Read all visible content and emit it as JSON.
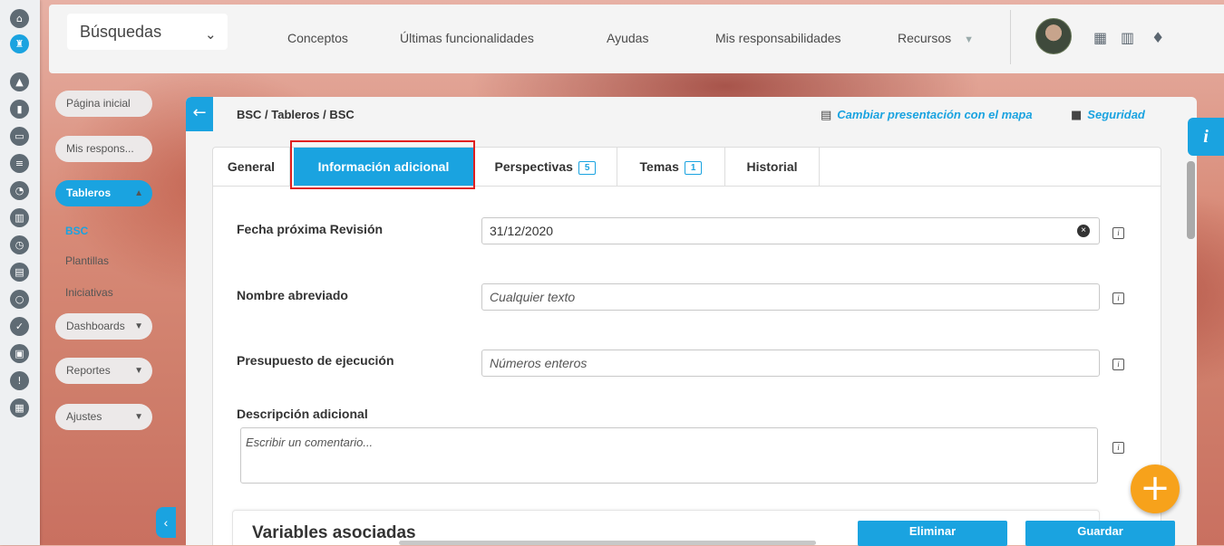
{
  "topbar": {
    "search_label": "Búsquedas",
    "nav": [
      "Conceptos",
      "Últimas funcionalidades",
      "Ayudas",
      "Mis responsabilidades",
      "Recursos"
    ]
  },
  "sidebar": {
    "items": [
      {
        "label": "Página inicial"
      },
      {
        "label": "Mis respons..."
      },
      {
        "label": "Tableros"
      },
      {
        "label": "BSC"
      },
      {
        "label": "Plantillas"
      },
      {
        "label": "Iniciativas"
      },
      {
        "label": "Dashboards"
      },
      {
        "label": "Reportes"
      },
      {
        "label": "Ajustes"
      }
    ]
  },
  "panel": {
    "breadcrumb": "BSC / Tableros / BSC",
    "map_link": "Cambiar presentación con el mapa",
    "security_link": "Seguridad"
  },
  "tabs": [
    {
      "label": "General"
    },
    {
      "label": "Información adicional"
    },
    {
      "label": "Perspectivas",
      "count": "5"
    },
    {
      "label": "Temas",
      "count": "1"
    },
    {
      "label": "Historial"
    }
  ],
  "form": {
    "fecha_label": "Fecha próxima Revisión",
    "fecha_value": "31/12/2020",
    "nombre_label": "Nombre abreviado",
    "nombre_placeholder": "Cualquier texto",
    "presupuesto_label": "Presupuesto de ejecución",
    "presupuesto_placeholder": "Números enteros",
    "descripcion_label": "Descripción adicional",
    "descripcion_placeholder": "Escribir un comentario..."
  },
  "variables": {
    "title": "Variables asociadas",
    "delete_label": "Eliminar",
    "save_label": "Guardar"
  },
  "info_tab": "i",
  "colors": {
    "accent": "#1aa3e0",
    "fab": "#f7a21b",
    "highlight": "#e02020"
  }
}
